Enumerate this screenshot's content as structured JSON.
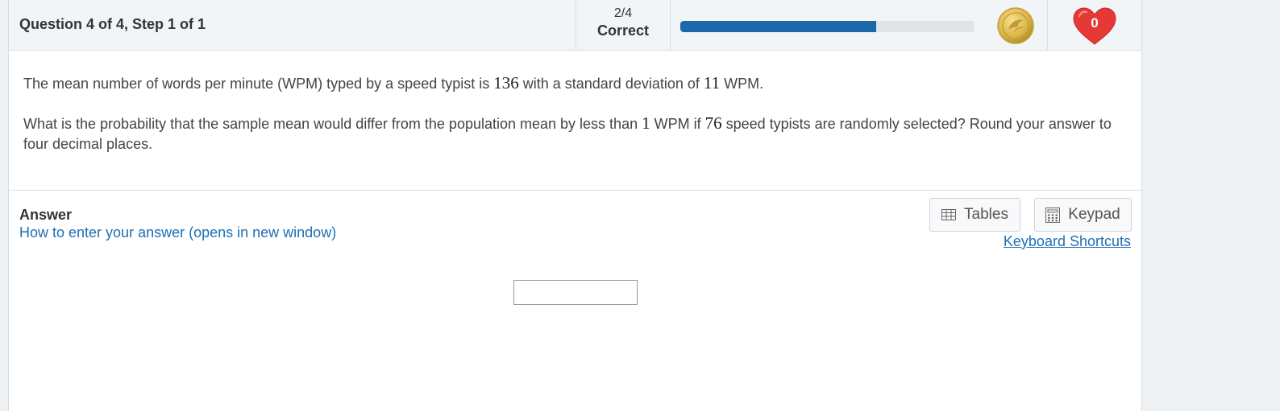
{
  "header": {
    "question_title": "Question 4 of 4, Step 1 of 1",
    "score_count": "2/4",
    "score_label": "Correct",
    "progress_fraction": 0.665,
    "progress_color": "#1b69aa",
    "coin_icon": "coin-icon",
    "lives_count": "0",
    "heart_color": "#e53935"
  },
  "question": {
    "p1_before": "The mean number of words per minute (WPM) typed by a speed typist is ",
    "p1_mean": "136",
    "p1_middle": " with a standard deviation of ",
    "p1_sd": "11",
    "p1_after": " WPM.",
    "p2_before": "What is the probability that the sample mean would differ from the population mean by less than ",
    "p2_diff": "1",
    "p2_middle": " WPM if ",
    "p2_n": "76",
    "p2_after": " speed typists are randomly selected? Round your answer to four decimal places."
  },
  "answer": {
    "label": "Answer",
    "help_link": "How to enter your answer (opens in new window)",
    "tables_label": "Tables",
    "keypad_label": "Keypad",
    "shortcuts_link": "Keyboard Shortcuts",
    "input_value": ""
  }
}
